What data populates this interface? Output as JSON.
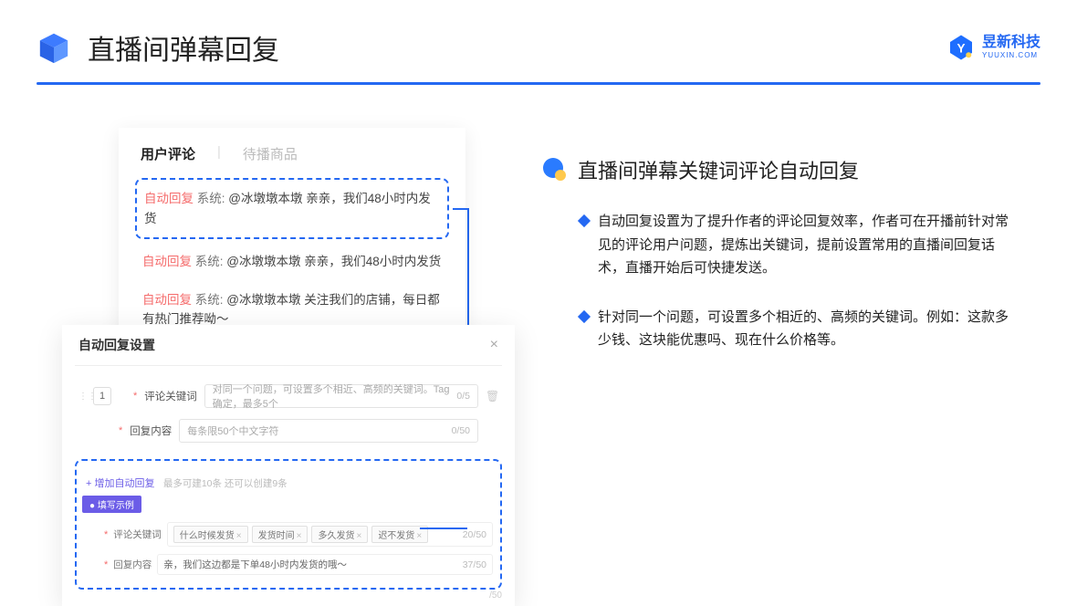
{
  "header": {
    "title": "直播间弹幕回复",
    "brand_cn": "昱新科技",
    "brand_en": "YUUXIN.COM"
  },
  "right": {
    "section_title": "直播间弹幕关键词评论自动回复",
    "bullets": [
      "自动回复设置为了提升作者的评论回复效率，作者可在开播前针对常见的评论用户问题，提炼出关键词，提前设置常用的直播间回复话术，直播开始后可快捷发送。",
      "针对同一个问题，可设置多个相近的、高频的关键词。例如：这款多少钱、这块能优惠吗、现在什么价格等。"
    ]
  },
  "comments_panel": {
    "tab_active": "用户评论",
    "tab_inactive": "待播商品",
    "auto_reply_label": "自动回复",
    "system_label": "系统:",
    "items": [
      "@冰墩墩本墩 亲亲，我们48小时内发货",
      "@冰墩墩本墩 亲亲，我们48小时内发货",
      "@冰墩墩本墩 关注我们的店铺，每日都有热门推荐呦～"
    ]
  },
  "settings_panel": {
    "title": "自动回复设置",
    "row_number": "1",
    "keyword_label": "评论关键词",
    "keyword_placeholder": "对同一个问题，可设置多个相近、高频的关键词。Tag确定，最多5个",
    "keyword_counter": "0/5",
    "content_label": "回复内容",
    "content_placeholder": "每条限50个中文字符",
    "content_counter": "0/50",
    "add_link": "+ 增加自动回复",
    "add_hint": "最多可建10条 还可以创建9条",
    "example_badge": "● 填写示例",
    "example_kw_label": "评论关键词",
    "example_tags": [
      "什么时候发货",
      "发货时间",
      "多久发货",
      "迟不发货"
    ],
    "example_kw_counter": "20/50",
    "example_reply_label": "回复内容",
    "example_reply_text": "亲，我们这边都是下单48小时内发货的哦～",
    "example_reply_counter": "37/50",
    "bottom_counter": "/50"
  }
}
